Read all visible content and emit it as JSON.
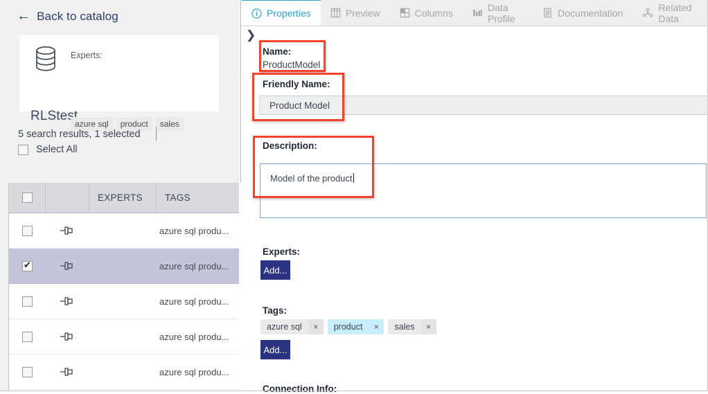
{
  "left": {
    "back_link": {
      "label": "Back to catalog",
      "icon": "arrow-left-icon"
    },
    "asset_card": {
      "icon": "database-icon",
      "name": "RLStest",
      "experts_label": "Experts:",
      "tags": [
        "azure sql",
        "product",
        "sales"
      ]
    },
    "results_text": "5 search results, 1 selected",
    "select_all_label": "Select All",
    "grid": {
      "columns": [
        "",
        "",
        "EXPERTS",
        "TAGS"
      ],
      "rows": [
        {
          "checked": false,
          "selected": false,
          "pin": "pin-icon",
          "experts": "",
          "tags": "azure sql produ..."
        },
        {
          "checked": true,
          "selected": true,
          "pin": "pin-icon",
          "experts": "",
          "tags": "azure sql produ..."
        },
        {
          "checked": false,
          "selected": false,
          "pin": "pin-icon",
          "experts": "",
          "tags": "azure sql produ..."
        },
        {
          "checked": false,
          "selected": false,
          "pin": "pin-icon",
          "experts": "",
          "tags": "azure sql produ..."
        },
        {
          "checked": false,
          "selected": false,
          "pin": "pin-icon",
          "experts": "",
          "tags": "azure sql produ..."
        }
      ]
    }
  },
  "tabs": [
    {
      "label": "Properties",
      "icon": "info-circle-icon",
      "active": true
    },
    {
      "label": "Preview",
      "icon": "table-icon",
      "active": false
    },
    {
      "label": "Columns",
      "icon": "columns-icon",
      "active": false
    },
    {
      "label": "Data Profile",
      "icon": "bar-chart-icon",
      "active": false
    },
    {
      "label": "Documentation",
      "icon": "document-icon",
      "active": false
    },
    {
      "label": "Related Data",
      "icon": "nodes-icon",
      "active": false
    }
  ],
  "form": {
    "expander_icon": "chevron-right-icon",
    "name_label": "Name:",
    "name_value": "ProductModel",
    "friendly_name_label": "Friendly Name:",
    "friendly_name_value": "Product Model",
    "description_label": "Description:",
    "description_value": "Model of the product",
    "experts_label": "Experts:",
    "experts_add_label": "Add...",
    "tags_label": "Tags:",
    "tags": [
      {
        "name": "azure sql",
        "remove": "×",
        "highlighted": false
      },
      {
        "name": "product",
        "remove": "×",
        "highlighted": true
      },
      {
        "name": "sales",
        "remove": "×",
        "highlighted": false
      }
    ],
    "tags_add_label": "Add...",
    "connection_info_label": "Connection Info:"
  },
  "colors": {
    "accent": "#2aa3c7",
    "button": "#2a3480",
    "annotation": "#f4422e",
    "selected_row": "#c3c5dd",
    "tag_highlight": "#c8eefb"
  }
}
